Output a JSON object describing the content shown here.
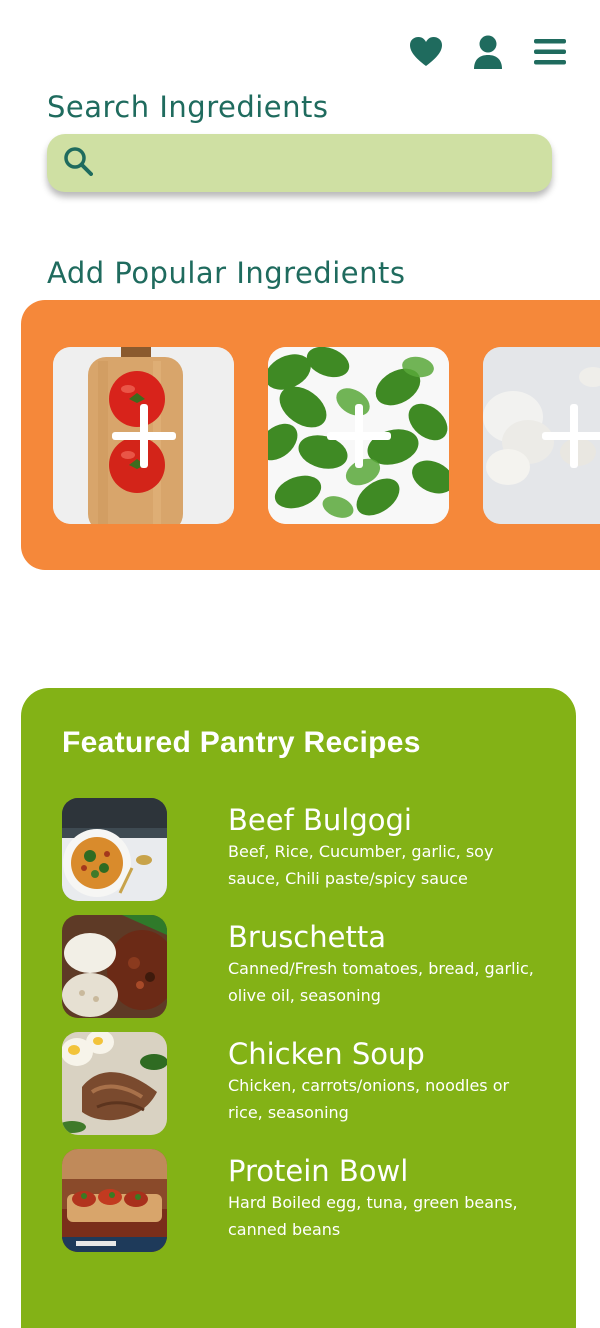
{
  "header": {
    "icons": [
      "heart-icon",
      "user-icon",
      "menu-icon"
    ]
  },
  "search": {
    "label": "Search Ingredients",
    "value": "",
    "placeholder": ""
  },
  "popular": {
    "label": "Add Popular Ingredients",
    "tiles": [
      {
        "name": "tomato",
        "icon": "plus-icon"
      },
      {
        "name": "basil",
        "icon": "plus-icon"
      },
      {
        "name": "garlic",
        "icon": "plus-icon"
      }
    ]
  },
  "featured": {
    "title": "Featured Pantry Recipes",
    "recipes": [
      {
        "name": "Beef Bulgogi",
        "ingredients": "Beef, Rice, Cucumber, garlic, soy sauce, Chili paste/spicy sauce"
      },
      {
        "name": "Bruschetta",
        "ingredients": "Canned/Fresh tomatoes, bread, garlic, olive oil, seasoning"
      },
      {
        "name": "Chicken Soup",
        "ingredients": "Chicken, carrots/onions, noodles or rice, seasoning"
      },
      {
        "name": "Protein Bowl",
        "ingredients": "Hard Boiled egg, tuna, green beans, canned beans"
      }
    ]
  },
  "colors": {
    "primary": "#1f6b5e",
    "search_bg": "#cfe0a3",
    "orange": "#f5883a",
    "green": "#83b216"
  }
}
